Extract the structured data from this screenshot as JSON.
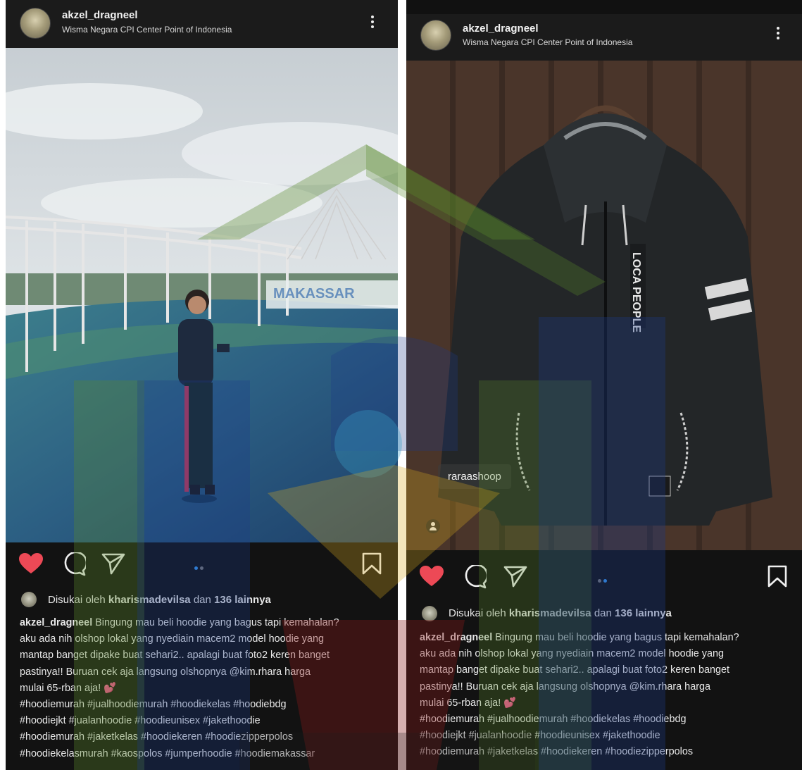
{
  "posts": [
    {
      "username": "akzel_dragneel",
      "location": "Wisma Negara CPI Center Point of Indonesia",
      "liked_by_prefix": "Disukai oleh",
      "liked_by_user": "kharismadevilsa",
      "liked_by_and": "dan",
      "liked_by_count": "136 lainnya",
      "caption_user": "akzel_dragneel",
      "caption_lines": [
        " Bingung mau beli hoodie yang bagus tapi kemahalan?",
        "aku ada nih olshop lokal yang nyediain macem2 model hoodie yang",
        "mantap banget dipake buat sehari2.. apalagi buat foto2 keren banget",
        "pastinya!! Buruan cek aja langsung olshopnya @kim.rhara harga",
        "mulai 65-rban aja! 💕"
      ],
      "hashtag_lines": [
        "#hoodiemurah #jualhoodiemurah #hoodiekelas #hoodiebdg",
        "#hoodiejkt #jualanhoodie #hoodieunisex #jakethoodie",
        "#hoodiemurah #jaketkelas #hoodiekeren #hoodiezipperpolos",
        "#hoodiekelasmurah #kaospolos #jumperhoodie #hoodiemakassar"
      ]
    },
    {
      "username": "akzel_dragneel",
      "location": "Wisma Negara CPI Center Point of Indonesia",
      "product_tag": "raraashoop",
      "jacket_print_1": "LOCA PEOPLE",
      "liked_by_prefix": "Disukai oleh",
      "liked_by_user": "kharismadevilsa",
      "liked_by_and": "dan",
      "liked_by_count": "136 lainnya",
      "caption_user": "akzel_dragneel",
      "caption_lines": [
        " Bingung mau beli hoodie yang bagus tapi kemahalan?",
        "aku ada nih olshop lokal yang nyediain macem2 model hoodie yang",
        "mantap banget dipake buat sehari2.. apalagi buat foto2 keren banget",
        "pastinya!! Buruan cek aja langsung olshopnya @kim.rhara harga",
        "mulai 65-rban aja! 💕"
      ],
      "hashtag_lines": [
        "#hoodiemurah #jualhoodiemurah #hoodiekelas #hoodiebdg",
        "#hoodiejkt #jualanhoodie #hoodieunisex #jakethoodie",
        "#hoodiemurah #jaketkelas #hoodiekeren #hoodiezipperpolos"
      ]
    }
  ],
  "colors": {
    "like_red": "#ed4956",
    "carousel_active": "#3897f0",
    "watermark_green": "#5a8a2a",
    "watermark_blue": "#1b3a8a",
    "watermark_red": "#8a1b1b",
    "watermark_yellow": "#d8a820"
  },
  "icons": [
    "heart-icon",
    "comment-icon",
    "share-icon",
    "bookmark-icon",
    "more-options-icon",
    "user-tag-icon"
  ]
}
